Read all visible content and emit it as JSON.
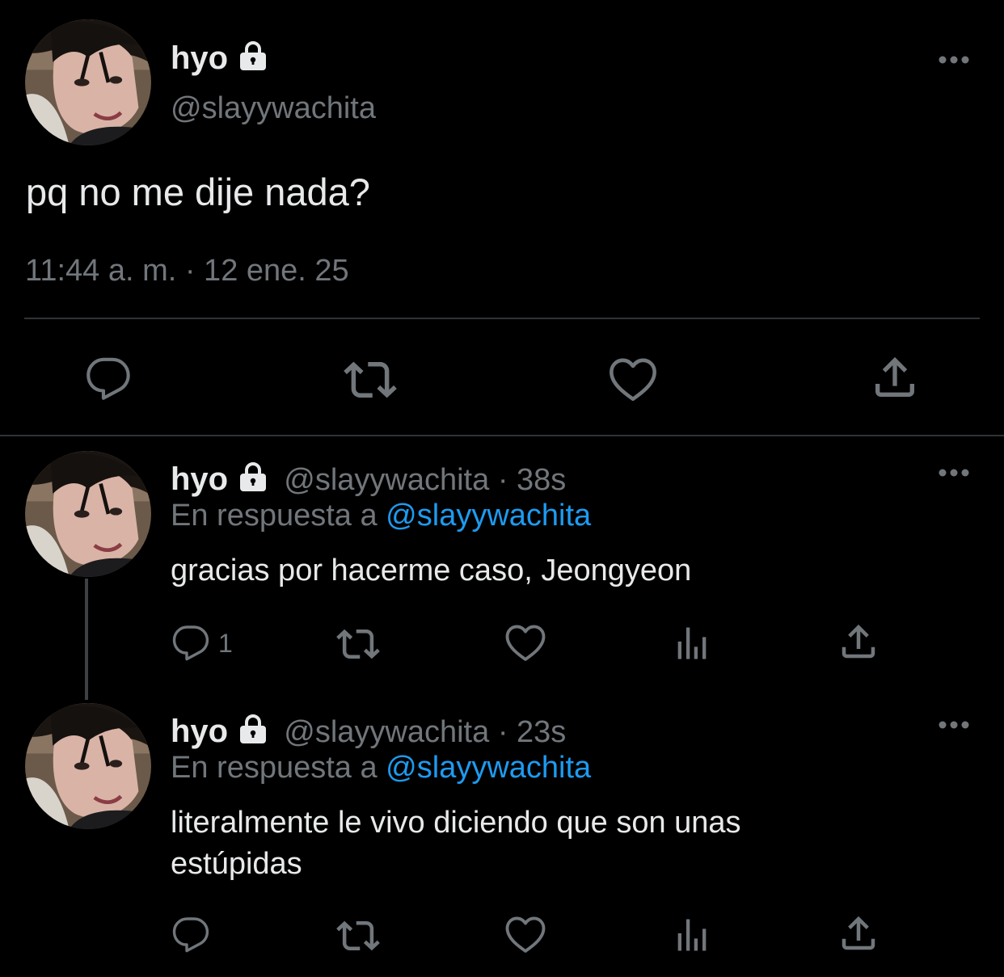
{
  "main_tweet": {
    "name": "hyo",
    "handle": "@slayywachita",
    "text": "pq no me dije nada?",
    "timestamp": "11:44 a. m. · 12 ene. 25",
    "actions": [
      "reply-icon",
      "retweet-icon",
      "like-icon",
      "share-icon"
    ]
  },
  "replies": [
    {
      "name": "hyo",
      "handle": "@slayywachita",
      "separator": "·",
      "time": "38s",
      "reply_prefix": "En respuesta a",
      "reply_to": "@slayywachita",
      "text": "gracias por hacerme caso, Jeongyeon",
      "reply_count": "1",
      "actions": [
        "reply-icon",
        "retweet-icon",
        "like-icon",
        "views-icon",
        "share-icon"
      ]
    },
    {
      "name": "hyo",
      "handle": "@slayywachita",
      "separator": "·",
      "time": "23s",
      "reply_prefix": "En respuesta a",
      "reply_to": "@slayywachita",
      "text_line1": "literalmente le vivo diciendo que son unas",
      "text_line2": "estúpidas",
      "actions": [
        "reply-icon",
        "retweet-icon",
        "like-icon",
        "views-icon",
        "share-icon"
      ]
    }
  ],
  "colors": {
    "background": "#000000",
    "text": "#e7e9ea",
    "muted": "#71767b",
    "link": "#1d9bf0",
    "divider": "#2f3336"
  }
}
